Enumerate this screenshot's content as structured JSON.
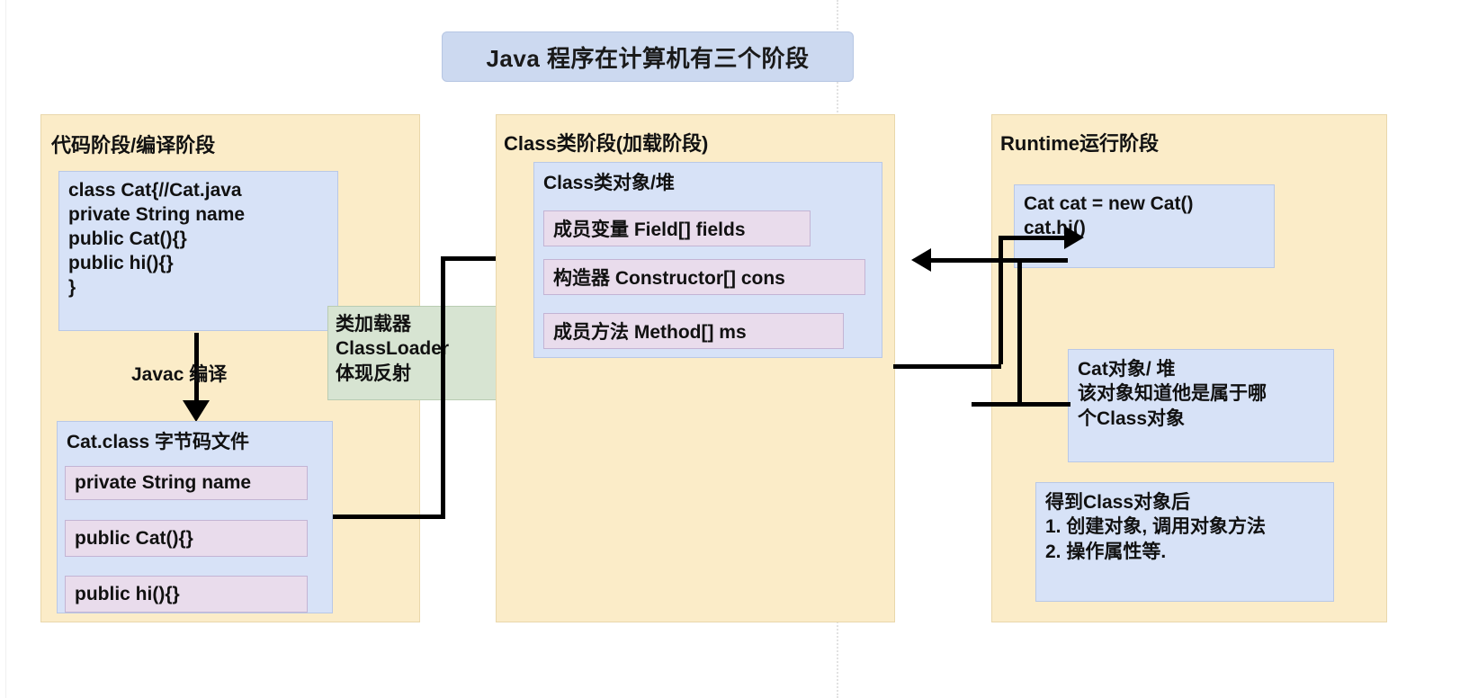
{
  "title": {
    "text": "Java 程序在计算机有三个阶段"
  },
  "stages": [
    {
      "id": "compile",
      "label": "代码阶段/编译阶段"
    },
    {
      "id": "classload",
      "label": "Class类阶段(加载阶段)"
    },
    {
      "id": "runtime",
      "label": "Runtime运行阶段"
    }
  ],
  "compile_stage": {
    "source_code": "class Cat{//Cat.java\nprivate String name\npublic Cat(){}\npublic hi(){}\n}",
    "compile_label": "Javac 编译",
    "bytecode_title": "Cat.class 字节码文件",
    "bytecode_members": [
      "private String name",
      "public Cat(){}",
      "public hi(){}"
    ]
  },
  "classloader_note": {
    "text": "类加载器\nClassLoader\n体现反射"
  },
  "class_stage": {
    "class_object_title": "Class类对象/堆",
    "members": [
      "成员变量 Field[] fields",
      "构造器 Constructor[] cons",
      "成员方法 Method[] ms"
    ]
  },
  "runtime_stage": {
    "code": "Cat cat = new Cat()\ncat.hi()",
    "cat_object_note": "Cat对象/ 堆\n该对象知道他是属于哪\n个Class对象",
    "usage_note": "得到Class对象后\n1. 创建对象, 调用对象方法\n2. 操作属性等."
  },
  "colors": {
    "stage_background": "#fbecc8",
    "stage_border": "#e9d7ab",
    "card_background": "#d7e2f7",
    "card_border": "#b9c8e6",
    "member_background": "#e9dcec",
    "member_border": "#c3b4d4",
    "note_background": "#d7e4d2",
    "note_border": "#b9ccb2",
    "title_background": "#ccd9f0",
    "connector": "#000000"
  }
}
